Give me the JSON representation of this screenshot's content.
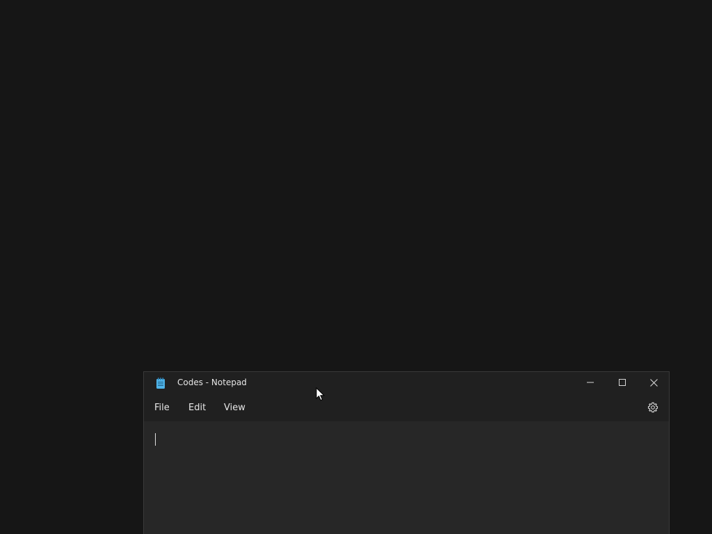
{
  "window": {
    "title": "Codes - Notepad",
    "app_icon": "notepad-icon",
    "controls": {
      "minimize": "minimize-icon",
      "maximize": "maximize-icon",
      "close": "close-icon"
    }
  },
  "menu": {
    "file": "File",
    "edit": "Edit",
    "view": "View",
    "settings_icon": "gear-icon"
  },
  "editor": {
    "content": ""
  },
  "colors": {
    "desktop_bg": "#161616",
    "titlebar_bg": "#202020",
    "editor_bg": "#272727",
    "text": "#e6e6e6",
    "icon_accent": "#4fb3e8"
  }
}
